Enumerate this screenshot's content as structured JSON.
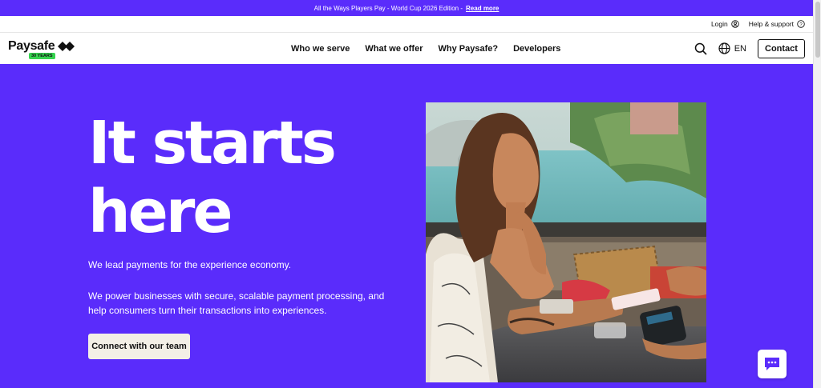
{
  "promo": {
    "text": "All the Ways Players Pay - World Cup 2026 Edition -",
    "link": "Read more"
  },
  "utility": {
    "login": "Login",
    "help": "Help & support"
  },
  "logo": {
    "name": "Paysafe",
    "badge": "30 YEARS"
  },
  "nav": {
    "items": [
      "Who we serve",
      "What we offer",
      "Why Paysafe?",
      "Developers"
    ],
    "language": "EN",
    "contact": "Contact"
  },
  "hero": {
    "title_line1": "It starts",
    "title_line2": "here",
    "subtitle": "We lead payments for the experience economy.",
    "body": "We power businesses with secure, scalable payment processing, and help consumers turn their transactions into experiences.",
    "cta": "Connect with our team"
  },
  "colors": {
    "brand": "#5a2cfb",
    "badge": "#35d34f",
    "cta_bg": "#f3efe6"
  },
  "icons": [
    "user-circle-icon",
    "help-circle-icon",
    "search-icon",
    "globe-icon",
    "chat-icon",
    "paysafe-diamond-icon"
  ]
}
